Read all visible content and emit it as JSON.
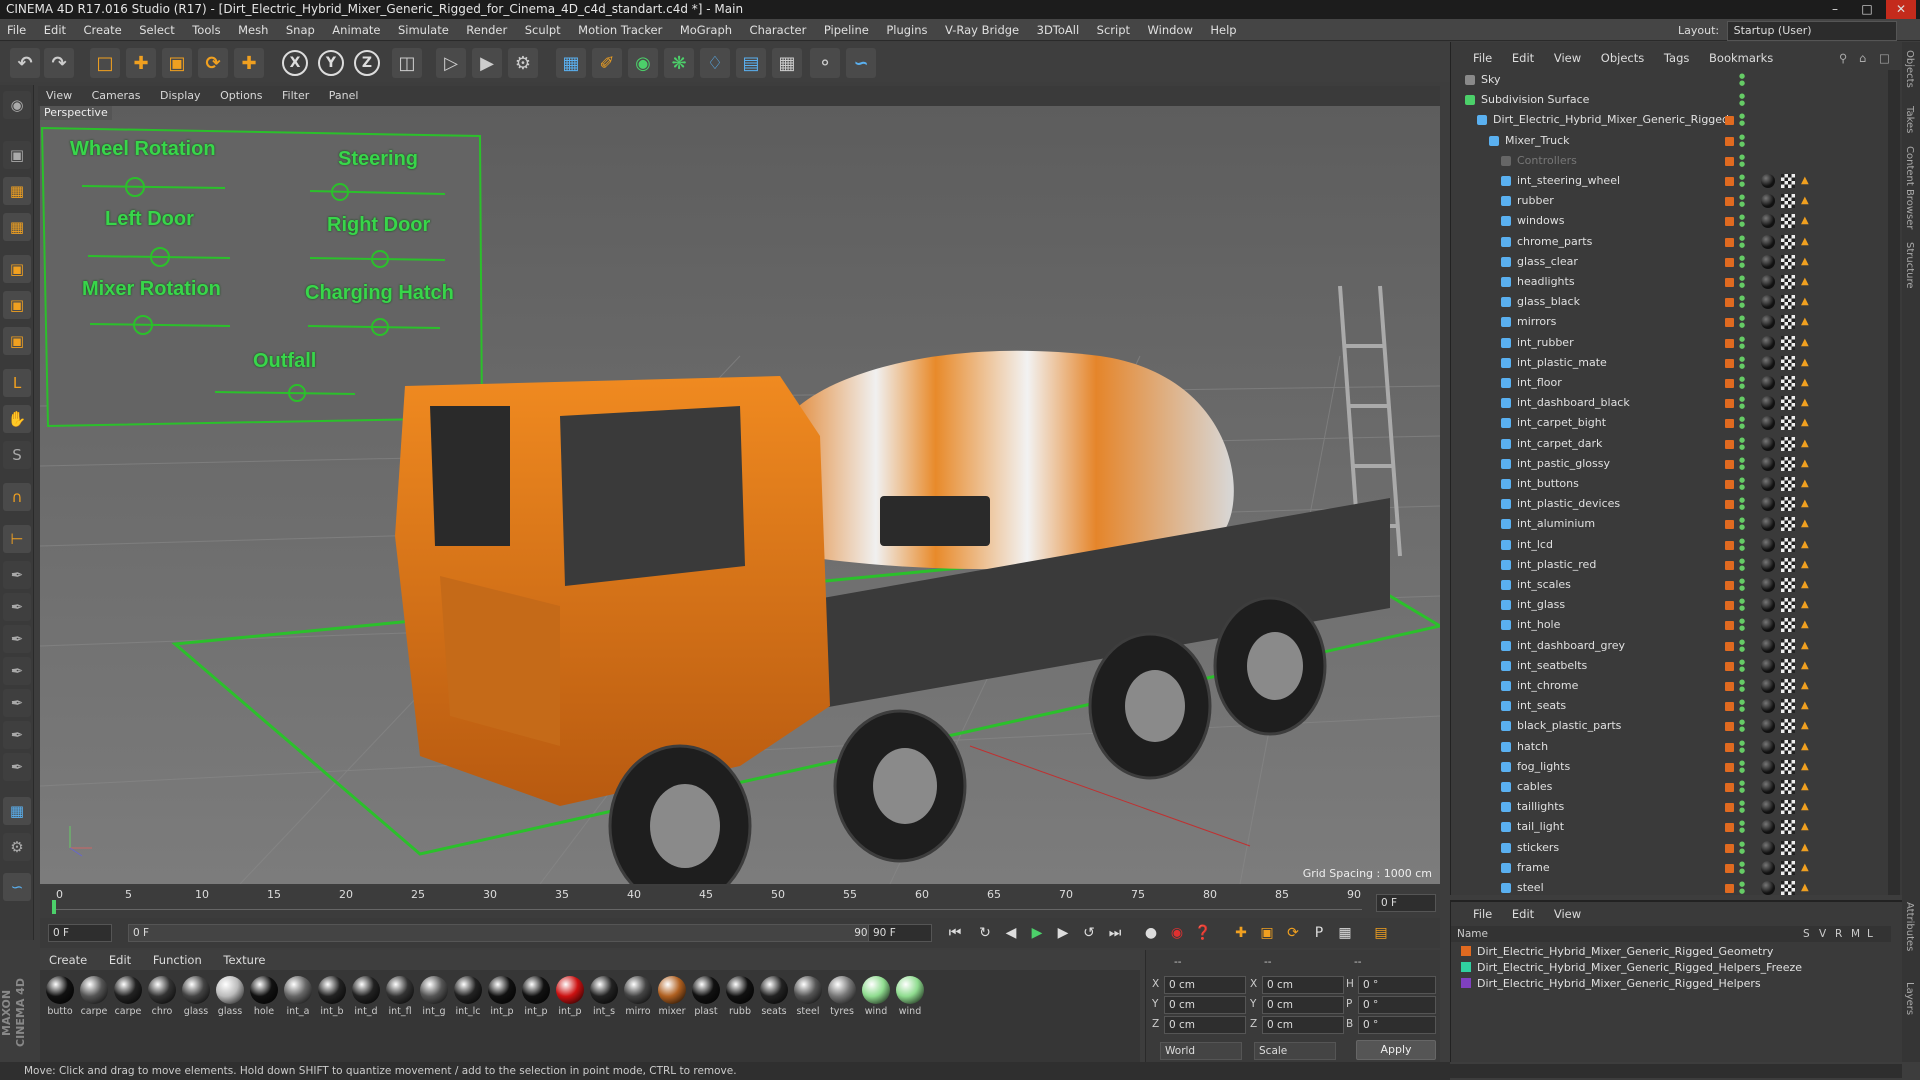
{
  "window": {
    "title": "CINEMA 4D R17.016 Studio (R17) - [Dirt_Electric_Hybrid_Mixer_Generic_Rigged_for_Cinema_4D_c4d_standart.c4d *] - Main"
  },
  "menubar": [
    "File",
    "Edit",
    "Create",
    "Select",
    "Tools",
    "Mesh",
    "Snap",
    "Animate",
    "Simulate",
    "Render",
    "Sculpt",
    "Motion Tracker",
    "MoGraph",
    "Character",
    "Pipeline",
    "Plugins",
    "V-Ray Bridge",
    "3DToAll",
    "Script",
    "Window",
    "Help"
  ],
  "layout": {
    "label": "Layout:",
    "value": "Startup (User)"
  },
  "toolbar": {
    "icons": [
      "undo-icon",
      "redo-icon",
      "live-selection-icon",
      "move-icon",
      "scale-icon",
      "rotate-icon",
      "coordinate-system-icon",
      "x-axis-lock",
      "y-axis-lock",
      "z-axis-lock",
      "world-coordinates-icon",
      "render-view-icon",
      "render-picture-viewer-icon",
      "edit-render-settings-icon",
      "cube-icon",
      "pen-spline-icon",
      "subdivision-surface-icon",
      "array-icon",
      "deformer-icon",
      "floor-icon",
      "camera-icon",
      "light-icon",
      "python-icon"
    ],
    "x": "X",
    "y": "Y",
    "z": "Z"
  },
  "viewport": {
    "menu": [
      "View",
      "Cameras",
      "Display",
      "Options",
      "Filter",
      "Panel"
    ],
    "label": "Perspective",
    "grid_spacing": "Grid Spacing : 1000 cm",
    "controllers": [
      "Wheel Rotation",
      "Steering",
      "Left Door",
      "Right Door",
      "Mixer Rotation",
      "Charging Hatch",
      "Outfall"
    ]
  },
  "timeline": {
    "ticks": [
      "0",
      "5",
      "10",
      "15",
      "20",
      "25",
      "30",
      "35",
      "40",
      "45",
      "50",
      "55",
      "60",
      "65",
      "70",
      "75",
      "80",
      "85",
      "90"
    ],
    "end_frame_field": "0 F",
    "start_field": "0 F",
    "range_start": "0 F",
    "range_end": "90 F",
    "max_field": "90 F"
  },
  "materials": {
    "menu": [
      "Create",
      "Edit",
      "Function",
      "Texture"
    ],
    "items": [
      {
        "name": "butto",
        "color": "#111111"
      },
      {
        "name": "carpe",
        "color": "#555555"
      },
      {
        "name": "carpe",
        "color": "#222222"
      },
      {
        "name": "chro",
        "color": "#333333"
      },
      {
        "name": "glass",
        "color": "#444444"
      },
      {
        "name": "glass",
        "color": "#bbbbbb"
      },
      {
        "name": "hole",
        "color": "#111111"
      },
      {
        "name": "int_a",
        "color": "#666666"
      },
      {
        "name": "int_b",
        "color": "#222222"
      },
      {
        "name": "int_d",
        "color": "#222222"
      },
      {
        "name": "int_fl",
        "color": "#333333"
      },
      {
        "name": "int_g",
        "color": "#555555"
      },
      {
        "name": "int_lc",
        "color": "#222222"
      },
      {
        "name": "int_p",
        "color": "#111111"
      },
      {
        "name": "int_p",
        "color": "#111111"
      },
      {
        "name": "int_p",
        "color": "#cc1111"
      },
      {
        "name": "int_s",
        "color": "#222222"
      },
      {
        "name": "mirro",
        "color": "#444444"
      },
      {
        "name": "mixer",
        "color": "#b06020"
      },
      {
        "name": "plast",
        "color": "#111111"
      },
      {
        "name": "rubb",
        "color": "#111111"
      },
      {
        "name": "seats",
        "color": "#222222"
      },
      {
        "name": "steel",
        "color": "#555555"
      },
      {
        "name": "tyres",
        "color": "#777777"
      },
      {
        "name": "wind",
        "color": "#8fdc8f"
      },
      {
        "name": "wind",
        "color": "#8fdc8f"
      }
    ]
  },
  "coords": {
    "header": [
      "--",
      "--",
      "--"
    ],
    "rows": [
      {
        "axis": "X",
        "pos": "0 cm",
        "axis2": "X",
        "size": "0 cm",
        "rot": "H",
        "rotv": "0 °"
      },
      {
        "axis": "Y",
        "pos": "0 cm",
        "axis2": "Y",
        "size": "0 cm",
        "rot": "P",
        "rotv": "0 °"
      },
      {
        "axis": "Z",
        "pos": "0 cm",
        "axis2": "Z",
        "size": "0 cm",
        "rot": "B",
        "rotv": "0 °"
      }
    ],
    "world": "World",
    "scale": "Scale",
    "apply": "Apply"
  },
  "status": "Move: Click and drag to move elements. Hold down SHIFT to quantize movement / add to the selection in point mode, CTRL to remove.",
  "maxon": "MAXON CINEMA 4D",
  "objects": {
    "menu": [
      "File",
      "Edit",
      "View",
      "Objects",
      "Tags",
      "Bookmarks"
    ],
    "rows": [
      {
        "name": "Sky",
        "indent": 0
      },
      {
        "name": "Subdivision Surface",
        "indent": 0
      },
      {
        "name": "Dirt_Electric_Hybrid_Mixer_Generic_Rigged",
        "indent": 1
      },
      {
        "name": "Mixer_Truck",
        "indent": 2
      },
      {
        "name": "Controllers",
        "indent": 3
      },
      {
        "name": "int_steering_wheel",
        "indent": 3
      },
      {
        "name": "rubber",
        "indent": 3
      },
      {
        "name": "windows",
        "indent": 3
      },
      {
        "name": "chrome_parts",
        "indent": 3
      },
      {
        "name": "glass_clear",
        "indent": 3
      },
      {
        "name": "headlights",
        "indent": 3
      },
      {
        "name": "glass_black",
        "indent": 3
      },
      {
        "name": "mirrors",
        "indent": 3
      },
      {
        "name": "int_rubber",
        "indent": 3
      },
      {
        "name": "int_plastic_mate",
        "indent": 3
      },
      {
        "name": "int_floor",
        "indent": 3
      },
      {
        "name": "int_dashboard_black",
        "indent": 3
      },
      {
        "name": "int_carpet_bight",
        "indent": 3
      },
      {
        "name": "int_carpet_dark",
        "indent": 3
      },
      {
        "name": "int_pastic_glossy",
        "indent": 3
      },
      {
        "name": "int_buttons",
        "indent": 3
      },
      {
        "name": "int_plastic_devices",
        "indent": 3
      },
      {
        "name": "int_aluminium",
        "indent": 3
      },
      {
        "name": "int_lcd",
        "indent": 3
      },
      {
        "name": "int_plastic_red",
        "indent": 3
      },
      {
        "name": "int_scales",
        "indent": 3
      },
      {
        "name": "int_glass",
        "indent": 3
      },
      {
        "name": "int_hole",
        "indent": 3
      },
      {
        "name": "int_dashboard_grey",
        "indent": 3
      },
      {
        "name": "int_seatbelts",
        "indent": 3
      },
      {
        "name": "int_chrome",
        "indent": 3
      },
      {
        "name": "int_seats",
        "indent": 3
      },
      {
        "name": "black_plastic_parts",
        "indent": 3
      },
      {
        "name": "hatch",
        "indent": 3
      },
      {
        "name": "fog_lights",
        "indent": 3
      },
      {
        "name": "cables",
        "indent": 3
      },
      {
        "name": "taillights",
        "indent": 3
      },
      {
        "name": "tail_light",
        "indent": 3
      },
      {
        "name": "stickers",
        "indent": 3
      },
      {
        "name": "frame",
        "indent": 3
      },
      {
        "name": "steel",
        "indent": 3
      }
    ]
  },
  "layers": {
    "menu": [
      "File",
      "Edit",
      "View"
    ],
    "header_name": "Name",
    "header_cols": [
      "S",
      "V",
      "R",
      "M",
      "L"
    ],
    "rows": [
      {
        "name": "Dirt_Electric_Hybrid_Mixer_Generic_Rigged_Geometry",
        "color": "#e06a20"
      },
      {
        "name": "Dirt_Electric_Hybrid_Mixer_Generic_Rigged_Helpers_Freeze",
        "color": "#30d0a0"
      },
      {
        "name": "Dirt_Electric_Hybrid_Mixer_Generic_Rigged_Helpers",
        "color": "#8040c0"
      }
    ]
  },
  "sidetabs": [
    "Objects",
    "Takes",
    "Content Browser",
    "Structure",
    "Attributes",
    "Layers"
  ]
}
